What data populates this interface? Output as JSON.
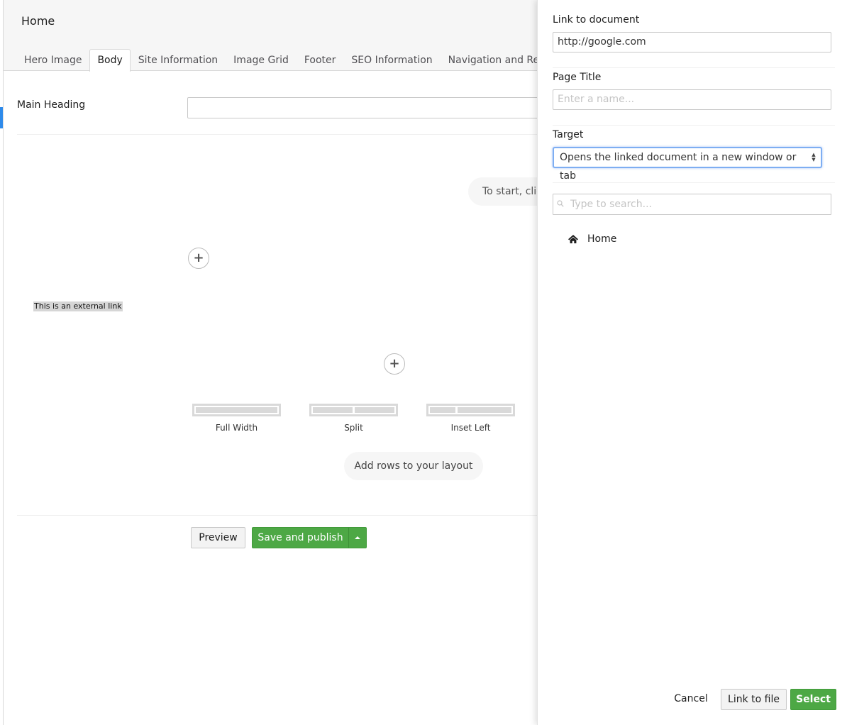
{
  "header": {
    "page_name": "Home",
    "tabs": [
      {
        "label": "Hero Image",
        "active": false
      },
      {
        "label": "Body",
        "active": true
      },
      {
        "label": "Site Information",
        "active": false
      },
      {
        "label": "Image Grid",
        "active": false
      },
      {
        "label": "Footer",
        "active": false
      },
      {
        "label": "SEO Information",
        "active": false
      },
      {
        "label": "Navigation and Redirects",
        "active": false
      }
    ]
  },
  "main": {
    "main_heading_label": "Main Heading",
    "main_heading_value": "",
    "grid_hint": "To start, click",
    "external_link_text": "This is an external link",
    "add_icon": "plus-icon",
    "layouts": [
      {
        "label": "Full Width",
        "columns": [
          1
        ]
      },
      {
        "label": "Split",
        "columns": [
          1,
          1
        ]
      },
      {
        "label": "Inset Left",
        "columns": [
          1,
          2
        ]
      }
    ],
    "add_rows_label": "Add rows to your layout",
    "preview_label": "Preview",
    "save_publish_label": "Save and publish",
    "save_caret_icon": "caret-up-icon"
  },
  "panel": {
    "link_label": "Link to document",
    "link_value": "http://google.com",
    "title_label": "Page Title",
    "title_placeholder": "Enter a name...",
    "target_label": "Target",
    "target_value": "Opens the linked document in a new window or tab",
    "search_placeholder": "Type to search...",
    "tree_root": "Home",
    "cancel_label": "Cancel",
    "link_file_label": "Link to file",
    "select_label": "Select"
  },
  "colors": {
    "accent": "#2e8aea",
    "success": "#4da845",
    "focus": "#7eaef2"
  }
}
